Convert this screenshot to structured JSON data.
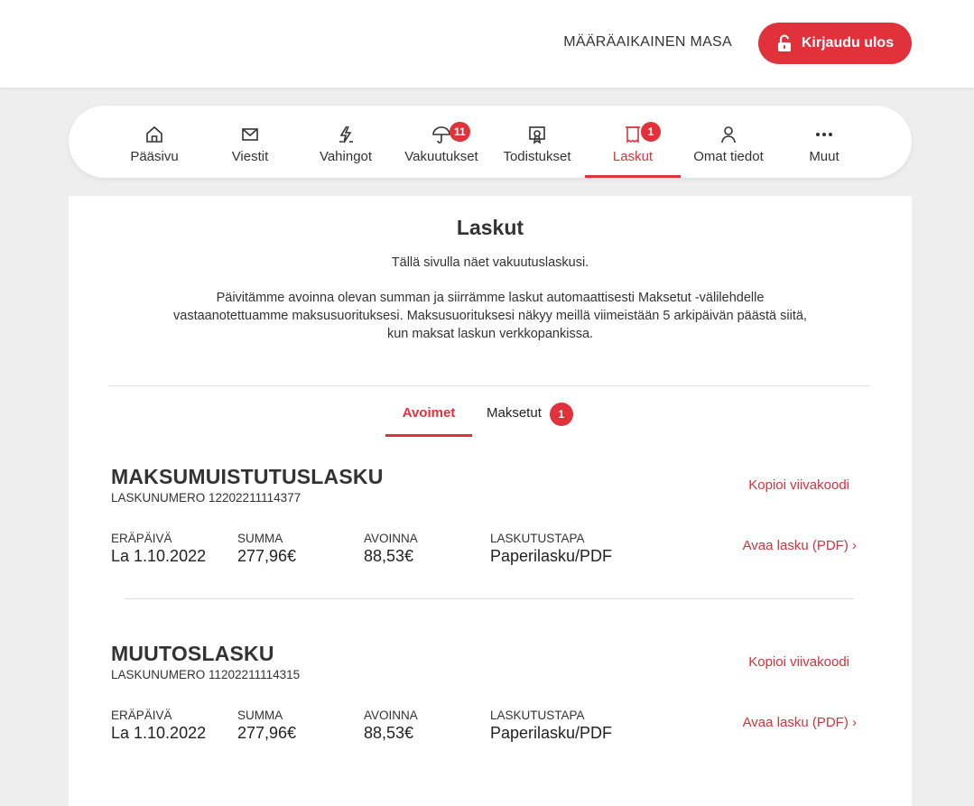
{
  "header": {
    "user_name": "MÄÄRÄAIKAINEN MASA",
    "logout_label": "Kirjaudu ulos"
  },
  "nav": {
    "items": [
      {
        "label": "Pääsivu",
        "icon": "home-icon"
      },
      {
        "label": "Viestit",
        "icon": "mail-icon"
      },
      {
        "label": "Vahingot",
        "icon": "lightning-icon"
      },
      {
        "label": "Vakuutukset",
        "icon": "umbrella-icon",
        "badge": "11"
      },
      {
        "label": "Todistukset",
        "icon": "certificate-icon"
      },
      {
        "label": "Laskut",
        "icon": "invoice-icon",
        "badge": "1",
        "active": true
      },
      {
        "label": "Omat tiedot",
        "icon": "person-icon"
      },
      {
        "label": "Muut",
        "icon": "more-icon"
      }
    ]
  },
  "main": {
    "title": "Laskut",
    "intro": "Tällä sivulla näet vakuutuslaskusi.",
    "description": "Päivitämme avoinna olevan summan ja siirrämme laskut automaattisesti Maksetut -välilehdelle vastaanotettuamme maksusuorituksesi. Maksusuorituksesi näkyy meillä viimeistään 5 arkipäivän päästä siitä, kun maksat laskun verkkopankissa.",
    "tabs": {
      "open_label": "Avoimet",
      "paid_label": "Maksetut",
      "paid_badge": "1"
    },
    "invoices": [
      {
        "title": "MAKSUMUISTUTUSLASKU",
        "number": "LASKUNUMERO 12202211114377",
        "copy_label": "Kopioi viivakoodi",
        "open_label": "Avaa lasku (PDF) ›",
        "due_label": "ERÄPÄIVÄ",
        "due_value": "La 1.10.2022",
        "sum_label": "SUMMA",
        "sum_value": "277,96€",
        "open_amount_label": "AVOINNA",
        "open_amount_value": "88,53€",
        "method_label": "LASKUTUSTAPA",
        "method_value": "Paperilasku/PDF"
      },
      {
        "title": "MUUTOSLASKU",
        "number": "LASKUNUMERO 11202211114315",
        "copy_label": "Kopioi viivakoodi",
        "open_label": "Avaa lasku (PDF) ›",
        "due_label": "ERÄPÄIVÄ",
        "due_value": "La 1.10.2022",
        "sum_label": "SUMMA",
        "sum_value": "277,96€",
        "open_amount_label": "AVOINNA",
        "open_amount_value": "88,53€",
        "method_label": "LASKUTUSTAPA",
        "method_value": "Paperilasku/PDF"
      }
    ]
  },
  "colors": {
    "accent": "#e1323c",
    "background": "#eeeeee",
    "text": "#333333"
  }
}
